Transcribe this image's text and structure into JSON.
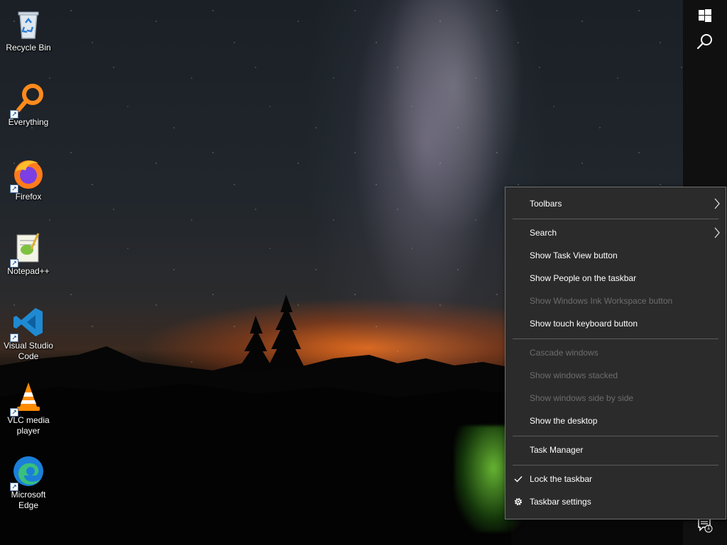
{
  "desktop": {
    "icons": [
      {
        "label": "Recycle Bin",
        "icon": "recycle-bin-icon"
      },
      {
        "label": "Everything",
        "icon": "everything-search-icon"
      },
      {
        "label": "Firefox",
        "icon": "firefox-icon"
      },
      {
        "label": "Notepad++",
        "icon": "notepad-plus-plus-icon"
      },
      {
        "label": "Visual Studio Code",
        "icon": "vscode-icon"
      },
      {
        "label": "VLC media player",
        "icon": "vlc-icon"
      },
      {
        "label": "Microsoft Edge",
        "icon": "edge-icon"
      }
    ]
  },
  "taskbar": {
    "start_icon": "windows-logo-icon",
    "search_icon": "search-icon",
    "notification_icon": "action-center-icon",
    "notification_count": "1"
  },
  "context_menu": {
    "items": [
      {
        "label": "Toolbars",
        "enabled": true,
        "submenu": true
      },
      {
        "label": "Search",
        "enabled": true,
        "submenu": true
      },
      {
        "label": "Show Task View button",
        "enabled": true
      },
      {
        "label": "Show People on the taskbar",
        "enabled": true
      },
      {
        "label": "Show Windows Ink Workspace button",
        "enabled": false
      },
      {
        "label": "Show touch keyboard button",
        "enabled": true
      },
      {
        "label": "Cascade windows",
        "enabled": false
      },
      {
        "label": "Show windows stacked",
        "enabled": false
      },
      {
        "label": "Show windows side by side",
        "enabled": false
      },
      {
        "label": "Show the desktop",
        "enabled": true
      },
      {
        "label": "Task Manager",
        "enabled": true
      },
      {
        "label": "Lock the taskbar",
        "enabled": true,
        "checked": true
      },
      {
        "label": "Taskbar settings",
        "enabled": true,
        "icon": "gear-icon"
      }
    ]
  },
  "colors": {
    "menu_bg": "#2b2b2b",
    "menu_text": "#ffffff",
    "menu_disabled_text": "#6d6d6d",
    "taskbar_bg": "#101010"
  }
}
